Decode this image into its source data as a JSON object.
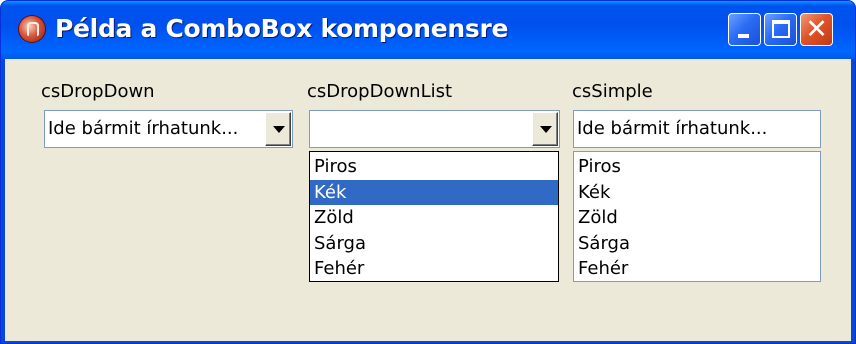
{
  "window": {
    "title": "Példa a ComboBox komponensre"
  },
  "combos": {
    "dropdown": {
      "label": "csDropDown",
      "value": "Ide bármit írhatunk..."
    },
    "dropdownlist": {
      "label": "csDropDownList",
      "value": "",
      "items": [
        "Piros",
        "Kék",
        "Zöld",
        "Sárga",
        "Fehér"
      ],
      "selected": "Kék"
    },
    "simple": {
      "label": "csSimple",
      "value": "Ide bármit írhatunk...",
      "items": [
        "Piros",
        "Kék",
        "Zöld",
        "Sárga",
        "Fehér"
      ]
    }
  },
  "colors": {
    "titlebar": "#0054e3",
    "client": "#ece9d8",
    "selection": "#316ac5",
    "field_border": "#7f9db9"
  },
  "icons": [
    "app-icon",
    "minimize-icon",
    "maximize-icon",
    "close-icon",
    "dropdown-arrow-icon"
  ]
}
